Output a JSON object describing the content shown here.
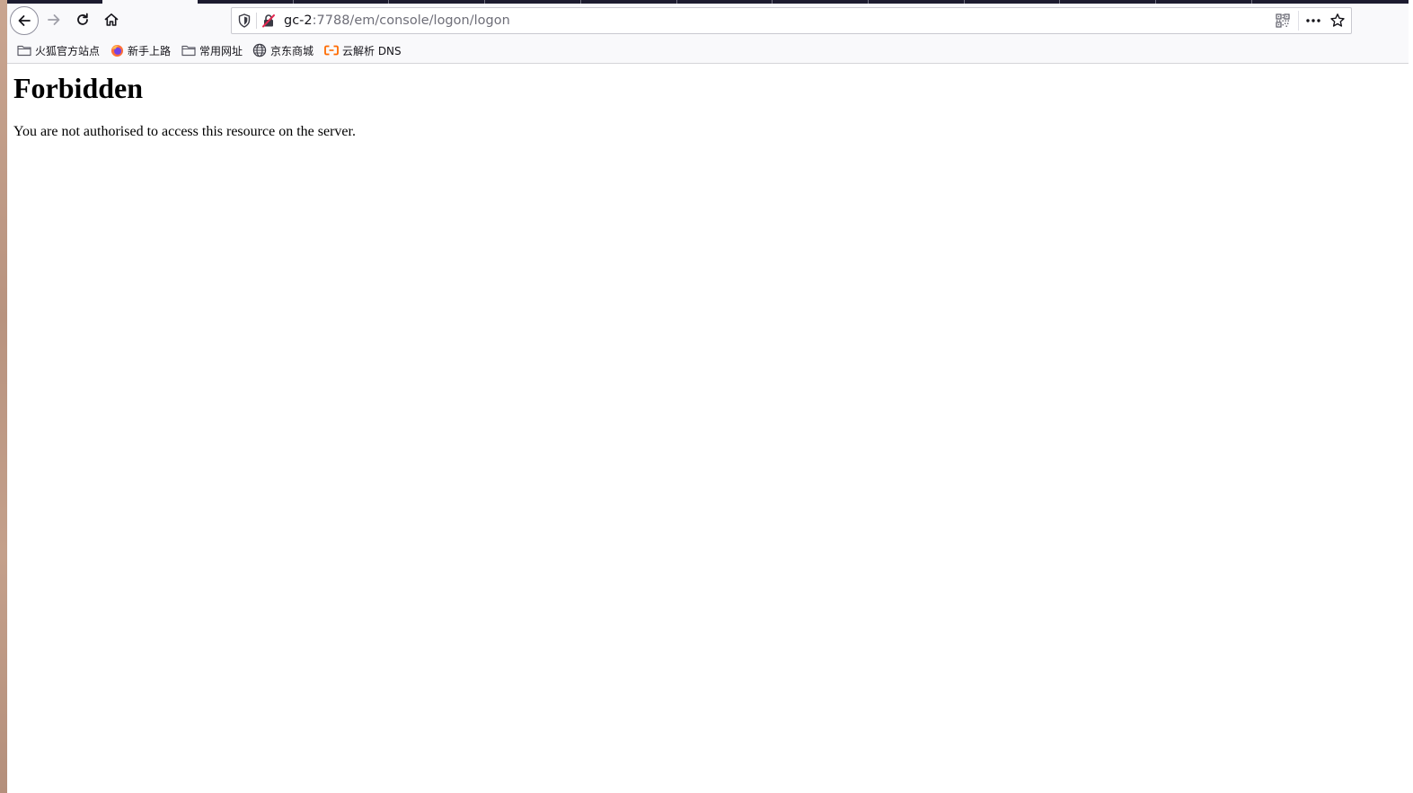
{
  "toolbar": {
    "back_icon": "arrow-left-icon",
    "forward_icon": "arrow-right-icon",
    "reload_icon": "reload-icon",
    "home_icon": "home-icon"
  },
  "address_bar": {
    "url_host": "gc-2",
    "url_rest": ":7788/em/console/logon/logon"
  },
  "bookmarks": [
    {
      "label": "火狐官方站点",
      "icon": "folder-icon"
    },
    {
      "label": "新手上路",
      "icon": "firefox-icon"
    },
    {
      "label": "常用网址",
      "icon": "folder-icon"
    },
    {
      "label": "京东商城",
      "icon": "globe-icon"
    },
    {
      "label": "云解析 DNS",
      "icon": "aliyun-icon"
    }
  ],
  "page": {
    "heading": "Forbidden",
    "message": "You are not authorised to access this resource on the server."
  },
  "colors": {
    "toolbar_bg": "#f9f9fb",
    "tab_strip": "#1c1b2f",
    "aliyun_orange": "#ff6a00"
  }
}
